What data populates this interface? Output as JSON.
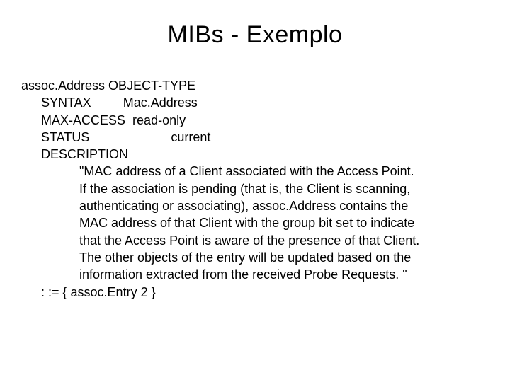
{
  "title": "MIBs - Exemplo",
  "mib": {
    "decl": "assoc.Address OBJECT-TYPE",
    "syntax_k": "SYNTAX",
    "syntax_v": "Mac.Address",
    "maxaccess_k": "MAX-ACCESS",
    "maxaccess_v": "read-only",
    "status_k": "STATUS",
    "status_v": "current",
    "description_k": "DESCRIPTION",
    "desc1": "\"MAC address of a Client associated with the Access Point.",
    "desc2": " If the association is pending (that is, the Client is scanning,",
    "desc3": " authenticating or associating), assoc.Address contains the",
    "desc4": "MAC address of that Client with the group bit set to indicate",
    "desc5": "that the Access Point is aware of the presence of that Client.",
    "desc6": "The other objects of the entry will be updated based on the",
    "desc7": " information extracted from the received Probe Requests. \"",
    "assign": ": := { assoc.Entry 2 }"
  }
}
